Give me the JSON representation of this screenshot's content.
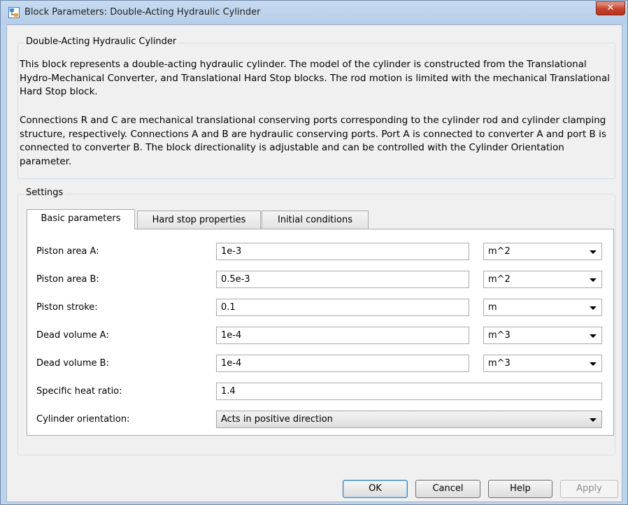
{
  "window": {
    "title": "Block Parameters: Double-Acting Hydraulic Cylinder",
    "close_glyph": "✕"
  },
  "description": {
    "group_title": "Double-Acting Hydraulic Cylinder",
    "para1": "This block represents a double-acting hydraulic cylinder. The model of the cylinder is constructed from the Translational Hydro-Mechanical Converter, and Translational Hard Stop blocks. The rod motion is limited with the mechanical Translational Hard Stop block.",
    "para2": "Connections R and C are mechanical translational conserving ports corresponding to the cylinder rod and cylinder clamping structure, respectively. Connections A and B are hydraulic conserving ports. Port A is connected to converter A and port B is connected to converter B. The block directionality is adjustable and can be controlled with the Cylinder Orientation parameter."
  },
  "settings": {
    "group_title": "Settings",
    "tabs": [
      {
        "label": "Basic parameters"
      },
      {
        "label": "Hard stop properties"
      },
      {
        "label": "Initial conditions"
      }
    ],
    "params": [
      {
        "label": "Piston area A:",
        "value": "1e-3",
        "unit": "m^2"
      },
      {
        "label": "Piston area B:",
        "value": "0.5e-3",
        "unit": "m^2"
      },
      {
        "label": "Piston stroke:",
        "value": "0.1",
        "unit": "m"
      },
      {
        "label": "Dead volume A:",
        "value": "1e-4",
        "unit": "m^3"
      },
      {
        "label": "Dead volume B:",
        "value": "1e-4",
        "unit": "m^3"
      },
      {
        "label": "Specific heat ratio:",
        "value": "1.4"
      },
      {
        "label": "Cylinder orientation:",
        "value": "Acts in positive direction"
      }
    ]
  },
  "buttons": {
    "ok": "OK",
    "cancel": "Cancel",
    "help": "Help",
    "apply": "Apply"
  },
  "colors": {
    "frame": "#bcd3ec",
    "client": "#f0f0f0",
    "close": "#c7422c",
    "default_button_border": "#3c7fb1"
  }
}
